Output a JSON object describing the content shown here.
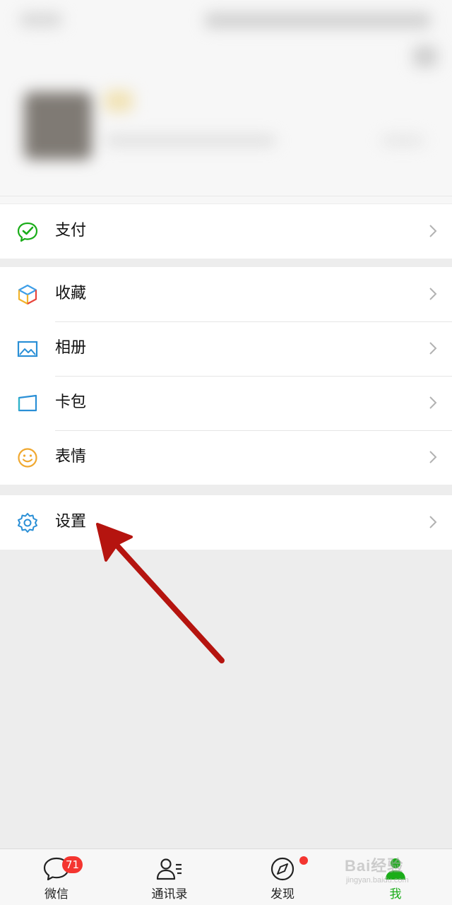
{
  "menu": {
    "pay": {
      "label": "支付",
      "icon": "wechat-pay-icon"
    },
    "favorites": {
      "label": "收藏",
      "icon": "favorites-cube-icon"
    },
    "album": {
      "label": "相册",
      "icon": "album-image-icon"
    },
    "cards": {
      "label": "卡包",
      "icon": "card-wallet-icon"
    },
    "stickers": {
      "label": "表情",
      "icon": "sticker-smile-icon"
    },
    "settings": {
      "label": "设置",
      "icon": "gear-icon"
    }
  },
  "tabbar": {
    "chats": {
      "label": "微信",
      "badge": "71",
      "icon": "chat-bubble-icon"
    },
    "contacts": {
      "label": "通讯录",
      "icon": "contacts-icon"
    },
    "discover": {
      "label": "发现",
      "icon": "compass-icon",
      "has_dot": true
    },
    "me": {
      "label": "我",
      "icon": "person-icon",
      "active": true
    }
  },
  "watermark": {
    "text": "Bai经验",
    "sub": "jingyan.baidu.com"
  },
  "colors": {
    "accent": "#1aad19",
    "badge": "#f43530",
    "arrow": "#b5140f"
  }
}
